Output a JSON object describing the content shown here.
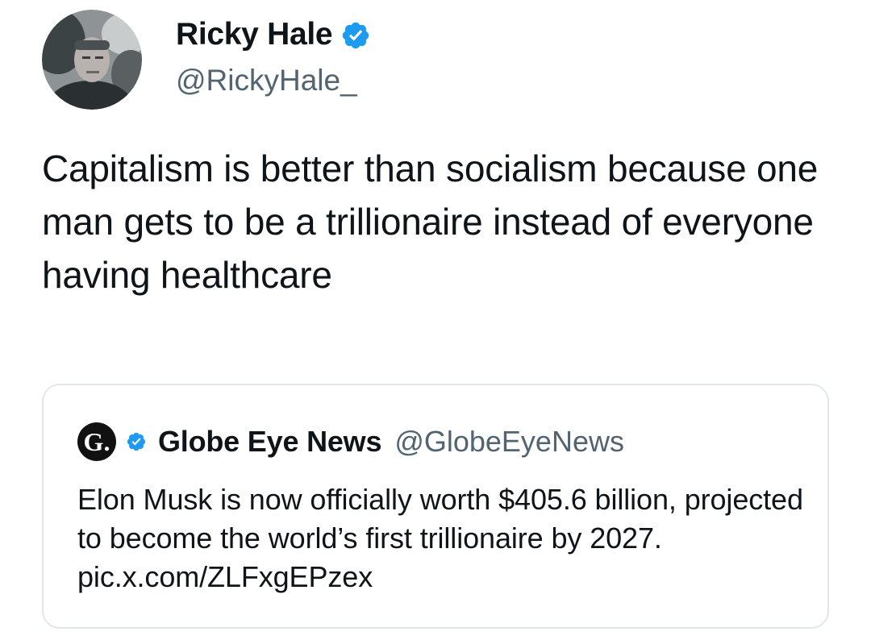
{
  "tweet": {
    "author": {
      "display_name": "Ricky Hale",
      "handle": "@RickyHale_",
      "verified": true,
      "avatar_icon": "profile-photo"
    },
    "text": "Capitalism is better than socialism because one man gets to be a trillionaire instead of everyone having healthcare"
  },
  "quoted_tweet": {
    "author": {
      "logo_letter": "G.",
      "display_name": "Globe Eye News",
      "handle": "@GlobeEyeNews",
      "verified": true
    },
    "text": "Elon Musk is now officially worth $405.6 billion, projected to become the world’s first trillionaire by 2027. pic.x.com/ZLFxgEPzex"
  },
  "colors": {
    "verified_badge": "#1d9bf0",
    "secondary_text": "#536471",
    "primary_text": "#0f1419",
    "card_border": "#e3e7ea"
  }
}
